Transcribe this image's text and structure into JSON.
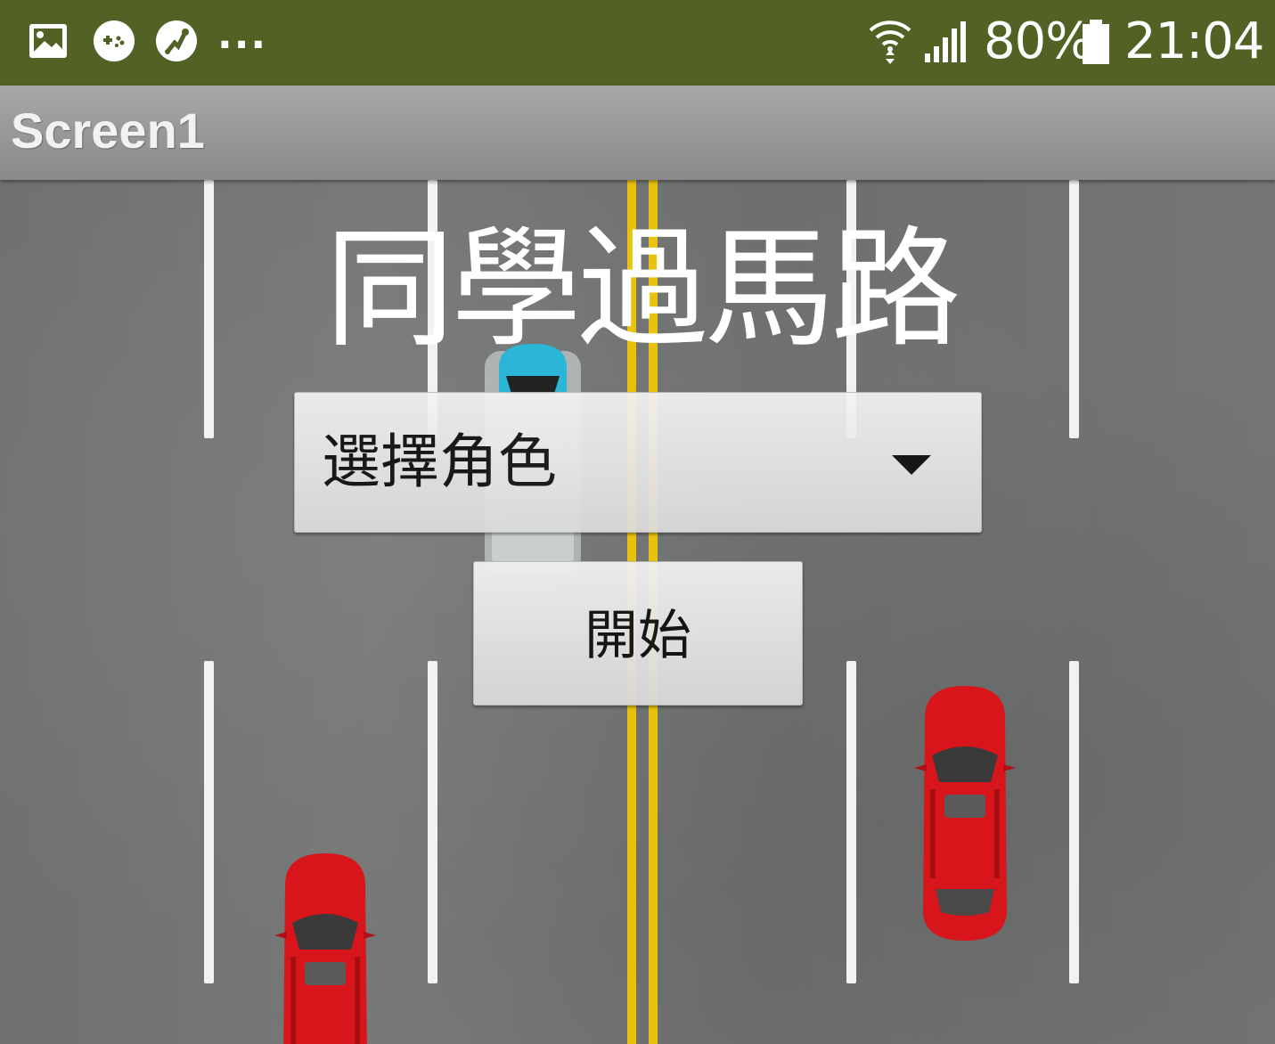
{
  "status_bar": {
    "icons": [
      "gallery-icon",
      "game-icon",
      "app-icon"
    ],
    "overflow": "...",
    "battery_percent": "80%",
    "time": "21:04",
    "background_color": "#526124"
  },
  "title_bar": {
    "title": "Screen1"
  },
  "game": {
    "title": "同學過馬路",
    "spinner": {
      "selected": "選擇角色"
    },
    "start_button": {
      "label": "開始"
    }
  }
}
